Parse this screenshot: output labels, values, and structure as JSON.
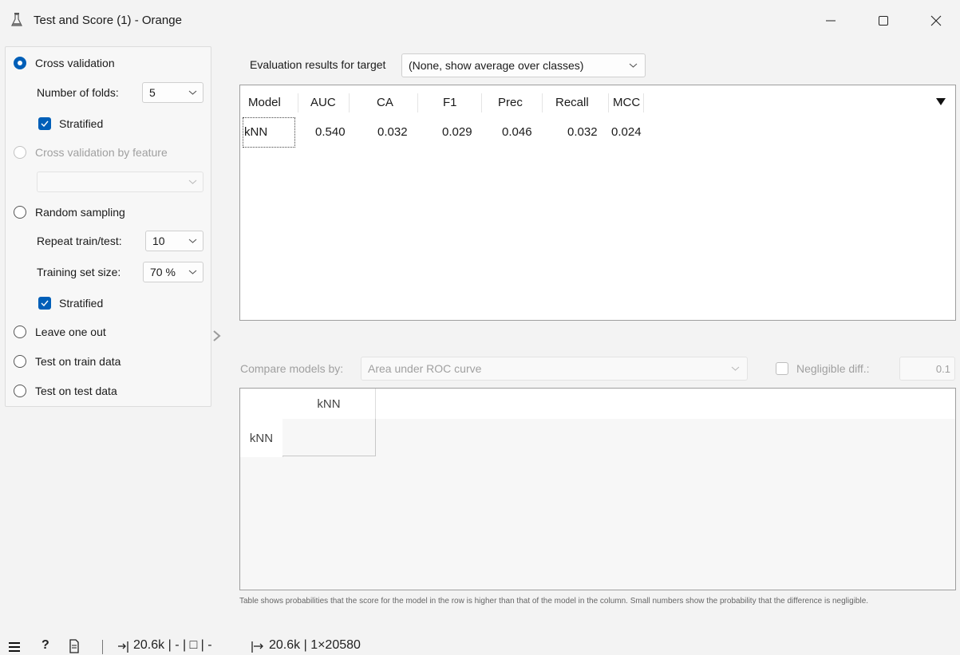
{
  "window": {
    "title": "Test and Score (1) - Orange",
    "icon": "flask-icon",
    "controls": [
      "minimize-icon",
      "maximize-icon",
      "close-icon"
    ]
  },
  "sampling": {
    "cross_validation": {
      "label": "Cross validation",
      "selected": true
    },
    "folds": {
      "label": "Number of folds:",
      "value": "5"
    },
    "stratified_cv": {
      "label": "Stratified",
      "checked": true
    },
    "cv_by_feature": {
      "label": "Cross validation by feature",
      "enabled": false,
      "value": ""
    },
    "random_sampling": {
      "label": "Random sampling",
      "selected": false
    },
    "repeat": {
      "label": "Repeat train/test:",
      "value": "10"
    },
    "train_size": {
      "label": "Training set size:",
      "value": "70 %"
    },
    "stratified_rs": {
      "label": "Stratified",
      "checked": true
    },
    "leave_one_out": {
      "label": "Leave one out",
      "selected": false
    },
    "test_on_train": {
      "label": "Test on train data",
      "selected": false
    },
    "test_on_test": {
      "label": "Test on test data",
      "selected": false
    }
  },
  "evaluation": {
    "target_label": "Evaluation results for target",
    "target_value": "(None, show average over classes)",
    "columns": [
      "Model",
      "AUC",
      "CA",
      "F1",
      "Prec",
      "Recall",
      "MCC"
    ],
    "rows": [
      {
        "model": "kNN",
        "auc": "0.540",
        "ca": "0.032",
        "f1": "0.029",
        "prec": "0.046",
        "recall": "0.032",
        "mcc": "0.024"
      }
    ]
  },
  "comparison": {
    "label": "Compare models by:",
    "value": "Area under ROC curve",
    "negligible_label": "Negligible diff.:",
    "negligible_checked": false,
    "negligible_value": "0.1",
    "col_model": "kNN",
    "row_model": "kNN",
    "note": "Table shows probabilities that the score for the model in the row is higher than that of the model in the column. Small numbers show the probability that the difference is negligible."
  },
  "status_bar": {
    "input_summary": "20.6k | - | □ | -",
    "output_summary": "20.6k | 1×20580"
  },
  "colors": {
    "accent": "#005fb8",
    "panel": "#f7f7f7",
    "background": "#f3f3f3"
  }
}
